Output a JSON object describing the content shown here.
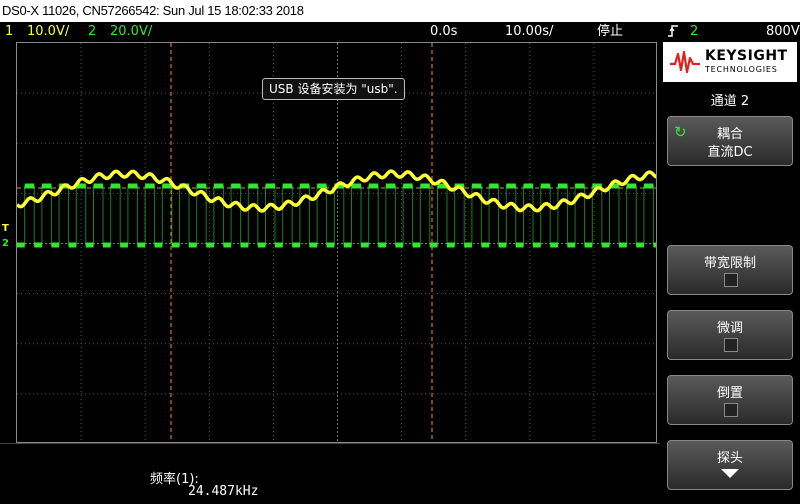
{
  "titlebar": {
    "text": "DS0-X 11026, CN57266542: Sun Jul 15 18:02:33 2018"
  },
  "status": {
    "ch1_num": "1",
    "ch1_scale": "10.0V/",
    "ch2_num": "2",
    "ch2_scale": "20.0V/",
    "time_pos": "0.0s",
    "time_scale": "10.00s/",
    "run_state": "停止",
    "trig_channel": "2",
    "trig_level": "800V"
  },
  "screen": {
    "notice": "USB 设备安装为 \"usb\".",
    "ch1_marker": "T",
    "ch2_marker": "2"
  },
  "measurement": {
    "label": "频率(1):",
    "value": "24.487kHz"
  },
  "softkey_panel": {
    "brand": "KEYSIGHT",
    "brand_sub": "TECHNOLOGIES",
    "menu_title": "通道 2",
    "coupling_label": "耦合",
    "coupling_value": "直流DC",
    "bw_limit_label": "带宽限制",
    "fine_label": "微调",
    "invert_label": "倒置",
    "probe_label": "探头"
  },
  "colors": {
    "ch1": "#ffff33",
    "ch2": "#33e633",
    "trigger": "#ff8c1a",
    "grid": "#555555"
  },
  "icons": {
    "trigger": "rising-edge-icon",
    "logo": "keysight-wave-icon",
    "cycle": "cycle-arrow-icon",
    "probe_more": "down-arrow-icon"
  }
}
